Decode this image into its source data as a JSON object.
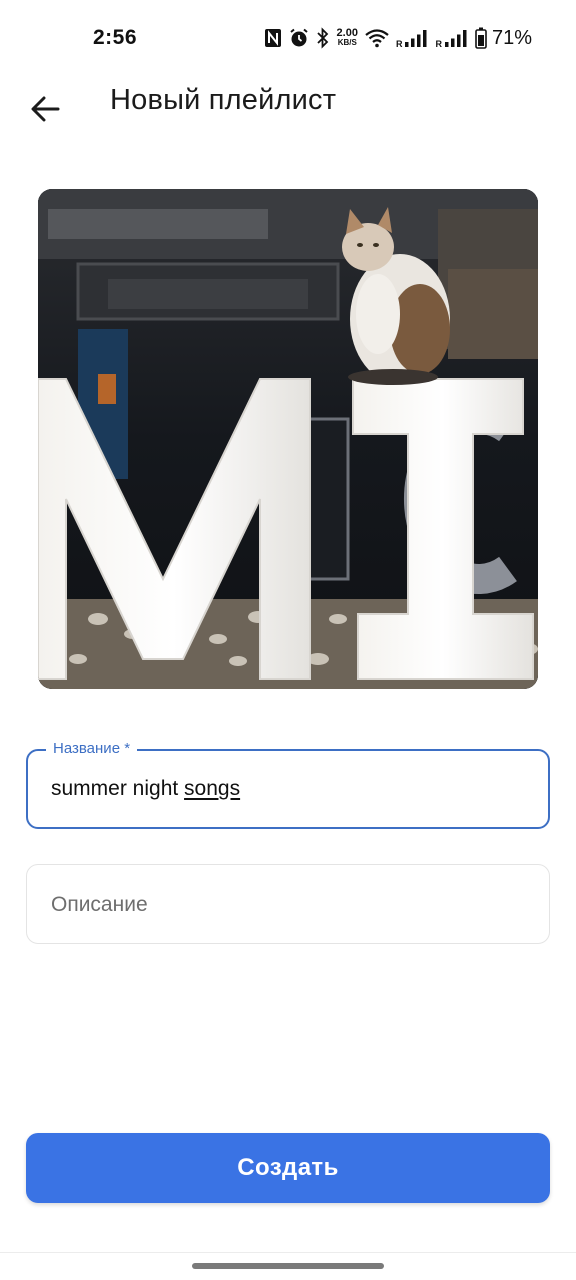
{
  "status_bar": {
    "time": "2:56",
    "net_speed_value": "2.00",
    "net_speed_unit": "KB/S",
    "sim1_label": "R",
    "sim2_label": "R",
    "battery_percent": "71%",
    "icons": [
      "nfc-icon",
      "alarm-icon",
      "bluetooth-icon",
      "wifi-icon",
      "signal-icon",
      "signal-icon",
      "battery-icon"
    ]
  },
  "header": {
    "back_icon": "arrow-left-icon",
    "title": "Новый плейлист"
  },
  "cover": {
    "letters": "MI"
  },
  "form": {
    "title_label": "Название *",
    "title_value_plain": "summer night ",
    "title_value_underlined": "songs",
    "description_placeholder": "Описание"
  },
  "actions": {
    "create_label": "Создать"
  },
  "colors": {
    "accent": "#3a73e4",
    "field_focus": "#3d6fc4"
  }
}
